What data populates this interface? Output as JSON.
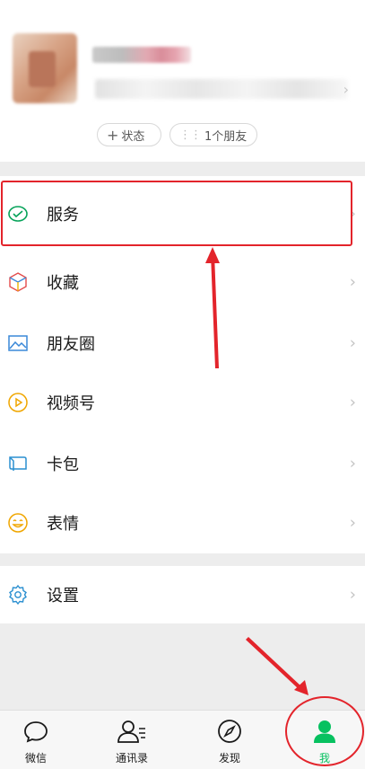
{
  "profile": {
    "status_label": "状态",
    "friends_label": "1个朋友"
  },
  "menu": {
    "items": [
      {
        "label": "服务",
        "icon": "service-icon"
      },
      {
        "label": "收藏",
        "icon": "favorites-icon"
      },
      {
        "label": "朋友圈",
        "icon": "moments-icon"
      },
      {
        "label": "视频号",
        "icon": "channels-icon"
      },
      {
        "label": "卡包",
        "icon": "card-wallet-icon"
      },
      {
        "label": "表情",
        "icon": "sticker-icon"
      }
    ],
    "settings": {
      "label": "设置",
      "icon": "settings-icon"
    }
  },
  "tabbar": {
    "tabs": [
      {
        "label": "微信",
        "icon": "chat-icon"
      },
      {
        "label": "通讯录",
        "icon": "contacts-icon"
      },
      {
        "label": "发现",
        "icon": "discover-icon"
      },
      {
        "label": "我",
        "icon": "me-icon",
        "active": true
      }
    ]
  },
  "colors": {
    "accent": "#07c160",
    "annotation": "#e3242b"
  }
}
